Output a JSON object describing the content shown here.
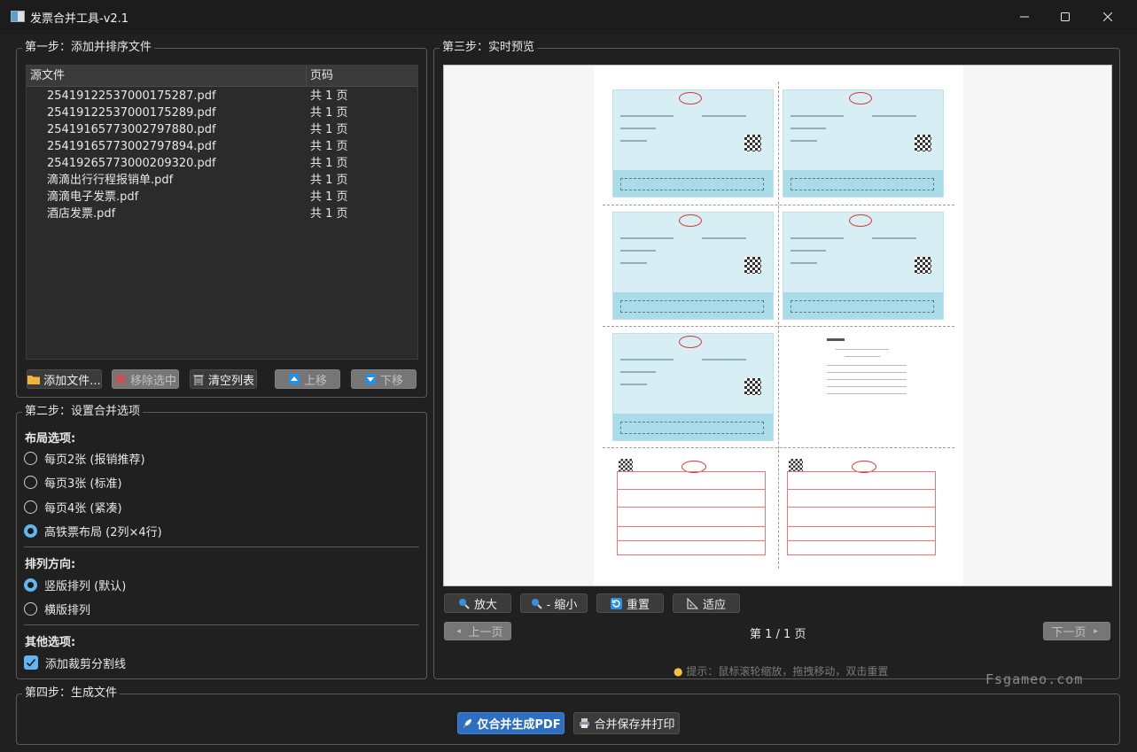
{
  "window": {
    "title": "发票合并工具-v2.1"
  },
  "step1": {
    "title": "第一步：添加并排序文件",
    "columns": [
      "源文件",
      "页码"
    ],
    "files": [
      {
        "name": "25419122537000175287.pdf",
        "pages": "共 1 页"
      },
      {
        "name": "25419122537000175289.pdf",
        "pages": "共 1 页"
      },
      {
        "name": "25419165773002797880.pdf",
        "pages": "共 1 页"
      },
      {
        "name": "25419165773002797894.pdf",
        "pages": "共 1 页"
      },
      {
        "name": "25419265773000209320.pdf",
        "pages": "共 1 页"
      },
      {
        "name": "滴滴出行行程报销单.pdf",
        "pages": "共 1 页"
      },
      {
        "name": "滴滴电子发票.pdf",
        "pages": "共 1 页"
      },
      {
        "name": "酒店发票.pdf",
        "pages": "共 1 页"
      }
    ],
    "buttons": {
      "add": "添加文件...",
      "remove": "移除选中",
      "clear": "清空列表",
      "up": "上移",
      "down": "下移"
    }
  },
  "step2": {
    "title": "第二步：设置合并选项",
    "layout_label": "布局选项:",
    "layout_options": [
      "每页2张 (报销推荐)",
      "每页3张 (标准)",
      "每页4张 (紧凑)",
      "高铁票布局 (2列×4行)"
    ],
    "layout_selected": 3,
    "direction_label": "排列方向:",
    "direction_options": [
      "竖版排列 (默认)",
      "横版排列"
    ],
    "direction_selected": 0,
    "other_label": "其他选项:",
    "cut_line_label": "添加裁剪分割线",
    "cut_line_checked": true
  },
  "step3": {
    "title": "第三步：实时预览",
    "zoom_in": "放大",
    "zoom_out": "- 缩小",
    "reset": "重置",
    "fit": "适应",
    "prev": "上一页",
    "page_indicator": "第 1 / 1 页",
    "next": "下一页",
    "hint": "提示：鼠标滚轮缩放，拖拽移动，双击重置"
  },
  "step4": {
    "title": "第四步：生成文件",
    "merge_only": "仅合并生成PDF",
    "merge_print": "合并保存并打印"
  },
  "watermark": "Fsgameo.com",
  "colors": {
    "accent": "#62b6ef",
    "primary_button": "#2f6fbf",
    "background": "#202020"
  }
}
